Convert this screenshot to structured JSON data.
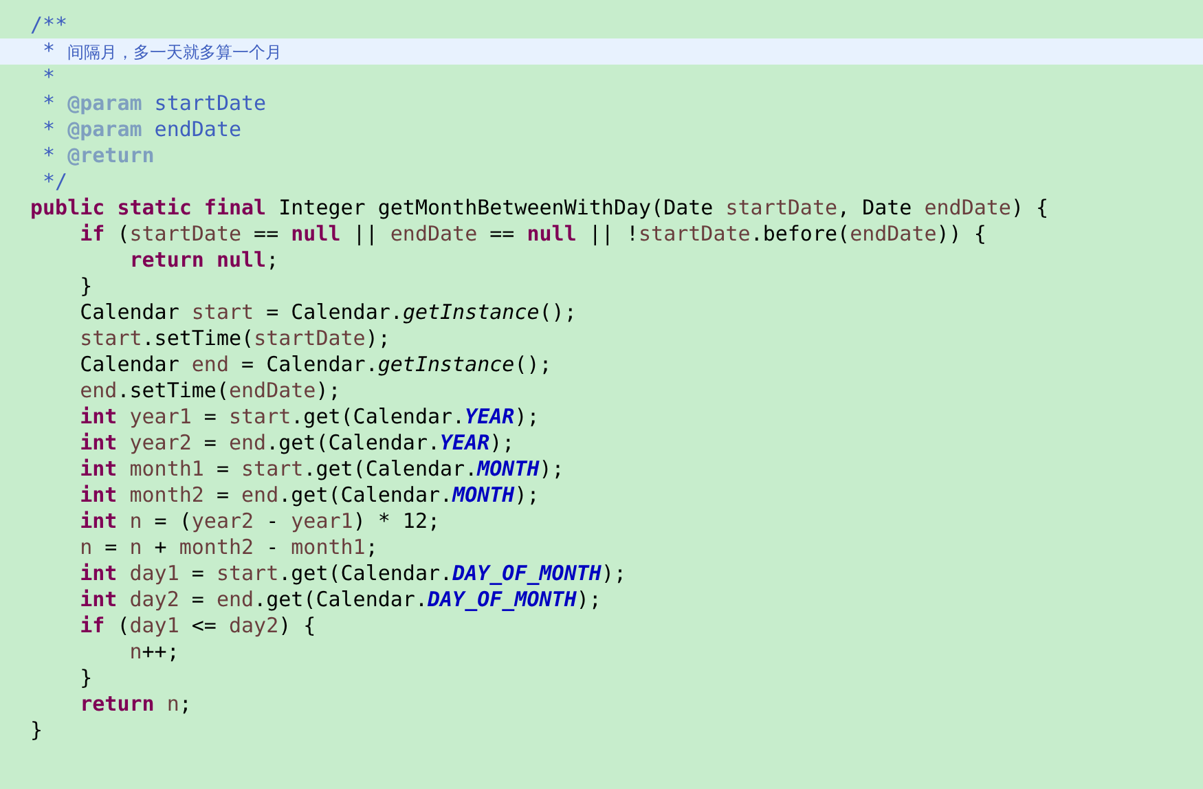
{
  "editor": {
    "lines": [
      {
        "highlighted": false,
        "tokens": [
          {
            "kind": "comment",
            "text": "/**"
          }
        ]
      },
      {
        "highlighted": true,
        "tokens": [
          {
            "kind": "comment",
            "text": " * "
          },
          {
            "kind": "comment_cjk",
            "text": "间隔月，多一天就多算一个月"
          }
        ]
      },
      {
        "highlighted": false,
        "tokens": [
          {
            "kind": "comment",
            "text": " *"
          }
        ]
      },
      {
        "highlighted": false,
        "tokens": [
          {
            "kind": "comment",
            "text": " * "
          },
          {
            "kind": "tag",
            "text": "@param"
          },
          {
            "kind": "comment",
            "text": " startDate"
          }
        ]
      },
      {
        "highlighted": false,
        "tokens": [
          {
            "kind": "comment",
            "text": " * "
          },
          {
            "kind": "tag",
            "text": "@param"
          },
          {
            "kind": "comment",
            "text": " endDate"
          }
        ]
      },
      {
        "highlighted": false,
        "tokens": [
          {
            "kind": "comment",
            "text": " * "
          },
          {
            "kind": "tag",
            "text": "@return"
          }
        ]
      },
      {
        "highlighted": false,
        "tokens": [
          {
            "kind": "comment",
            "text": " */"
          }
        ]
      },
      {
        "highlighted": false,
        "tokens": [
          {
            "kind": "keyword",
            "text": "public static final"
          },
          {
            "kind": "plain",
            "text": " Integer getMonthBetweenWithDay(Date "
          },
          {
            "kind": "variable",
            "text": "startDate"
          },
          {
            "kind": "plain",
            "text": ", Date "
          },
          {
            "kind": "variable",
            "text": "endDate"
          },
          {
            "kind": "plain",
            "text": ") {"
          }
        ]
      },
      {
        "highlighted": false,
        "tokens": [
          {
            "kind": "keyword",
            "text": "    if"
          },
          {
            "kind": "plain",
            "text": " ("
          },
          {
            "kind": "variable",
            "text": "startDate"
          },
          {
            "kind": "plain",
            "text": " == "
          },
          {
            "kind": "keyword",
            "text": "null"
          },
          {
            "kind": "plain",
            "text": " || "
          },
          {
            "kind": "variable",
            "text": "endDate"
          },
          {
            "kind": "plain",
            "text": " == "
          },
          {
            "kind": "keyword",
            "text": "null"
          },
          {
            "kind": "plain",
            "text": " || !"
          },
          {
            "kind": "variable",
            "text": "startDate"
          },
          {
            "kind": "plain",
            "text": ".before("
          },
          {
            "kind": "variable",
            "text": "endDate"
          },
          {
            "kind": "plain",
            "text": ")) {"
          }
        ]
      },
      {
        "highlighted": false,
        "tokens": [
          {
            "kind": "keyword",
            "text": "        return null"
          },
          {
            "kind": "plain",
            "text": ";"
          }
        ]
      },
      {
        "highlighted": false,
        "tokens": [
          {
            "kind": "plain",
            "text": "    }"
          }
        ]
      },
      {
        "highlighted": false,
        "tokens": [
          {
            "kind": "plain",
            "text": "    Calendar "
          },
          {
            "kind": "variable",
            "text": "start"
          },
          {
            "kind": "plain",
            "text": " = Calendar."
          },
          {
            "kind": "method",
            "text": "getInstance"
          },
          {
            "kind": "plain",
            "text": "();"
          }
        ]
      },
      {
        "highlighted": false,
        "tokens": [
          {
            "kind": "variable",
            "text": "    start"
          },
          {
            "kind": "plain",
            "text": ".setTime("
          },
          {
            "kind": "variable",
            "text": "startDate"
          },
          {
            "kind": "plain",
            "text": ");"
          }
        ]
      },
      {
        "highlighted": false,
        "tokens": [
          {
            "kind": "plain",
            "text": "    Calendar "
          },
          {
            "kind": "variable",
            "text": "end"
          },
          {
            "kind": "plain",
            "text": " = Calendar."
          },
          {
            "kind": "method",
            "text": "getInstance"
          },
          {
            "kind": "plain",
            "text": "();"
          }
        ]
      },
      {
        "highlighted": false,
        "tokens": [
          {
            "kind": "variable",
            "text": "    end"
          },
          {
            "kind": "plain",
            "text": ".setTime("
          },
          {
            "kind": "variable",
            "text": "endDate"
          },
          {
            "kind": "plain",
            "text": ");"
          }
        ]
      },
      {
        "highlighted": false,
        "tokens": [
          {
            "kind": "keyword",
            "text": "    int"
          },
          {
            "kind": "variable",
            "text": " year1"
          },
          {
            "kind": "plain",
            "text": " = "
          },
          {
            "kind": "variable",
            "text": "start"
          },
          {
            "kind": "plain",
            "text": ".get(Calendar."
          },
          {
            "kind": "field",
            "text": "YEAR"
          },
          {
            "kind": "plain",
            "text": ");"
          }
        ]
      },
      {
        "highlighted": false,
        "tokens": [
          {
            "kind": "keyword",
            "text": "    int"
          },
          {
            "kind": "variable",
            "text": " year2"
          },
          {
            "kind": "plain",
            "text": " = "
          },
          {
            "kind": "variable",
            "text": "end"
          },
          {
            "kind": "plain",
            "text": ".get(Calendar."
          },
          {
            "kind": "field",
            "text": "YEAR"
          },
          {
            "kind": "plain",
            "text": ");"
          }
        ]
      },
      {
        "highlighted": false,
        "tokens": [
          {
            "kind": "keyword",
            "text": "    int"
          },
          {
            "kind": "variable",
            "text": " month1"
          },
          {
            "kind": "plain",
            "text": " = "
          },
          {
            "kind": "variable",
            "text": "start"
          },
          {
            "kind": "plain",
            "text": ".get(Calendar."
          },
          {
            "kind": "field",
            "text": "MONTH"
          },
          {
            "kind": "plain",
            "text": ");"
          }
        ]
      },
      {
        "highlighted": false,
        "tokens": [
          {
            "kind": "keyword",
            "text": "    int"
          },
          {
            "kind": "variable",
            "text": " month2"
          },
          {
            "kind": "plain",
            "text": " = "
          },
          {
            "kind": "variable",
            "text": "end"
          },
          {
            "kind": "plain",
            "text": ".get(Calendar."
          },
          {
            "kind": "field",
            "text": "MONTH"
          },
          {
            "kind": "plain",
            "text": ");"
          }
        ]
      },
      {
        "highlighted": false,
        "tokens": [
          {
            "kind": "keyword",
            "text": "    int"
          },
          {
            "kind": "variable",
            "text": " n"
          },
          {
            "kind": "plain",
            "text": " = ("
          },
          {
            "kind": "variable",
            "text": "year2"
          },
          {
            "kind": "plain",
            "text": " - "
          },
          {
            "kind": "variable",
            "text": "year1"
          },
          {
            "kind": "plain",
            "text": ") * 12;"
          }
        ]
      },
      {
        "highlighted": false,
        "tokens": [
          {
            "kind": "variable",
            "text": "    n"
          },
          {
            "kind": "plain",
            "text": " = "
          },
          {
            "kind": "variable",
            "text": "n"
          },
          {
            "kind": "plain",
            "text": " + "
          },
          {
            "kind": "variable",
            "text": "month2"
          },
          {
            "kind": "plain",
            "text": " - "
          },
          {
            "kind": "variable",
            "text": "month1"
          },
          {
            "kind": "plain",
            "text": ";"
          }
        ]
      },
      {
        "highlighted": false,
        "tokens": [
          {
            "kind": "keyword",
            "text": "    int"
          },
          {
            "kind": "variable",
            "text": " day1"
          },
          {
            "kind": "plain",
            "text": " = "
          },
          {
            "kind": "variable",
            "text": "start"
          },
          {
            "kind": "plain",
            "text": ".get(Calendar."
          },
          {
            "kind": "field",
            "text": "DAY_OF_MONTH"
          },
          {
            "kind": "plain",
            "text": ");"
          }
        ]
      },
      {
        "highlighted": false,
        "tokens": [
          {
            "kind": "keyword",
            "text": "    int"
          },
          {
            "kind": "variable",
            "text": " day2"
          },
          {
            "kind": "plain",
            "text": " = "
          },
          {
            "kind": "variable",
            "text": "end"
          },
          {
            "kind": "plain",
            "text": ".get(Calendar."
          },
          {
            "kind": "field",
            "text": "DAY_OF_MONTH"
          },
          {
            "kind": "plain",
            "text": ");"
          }
        ]
      },
      {
        "highlighted": false,
        "tokens": [
          {
            "kind": "keyword",
            "text": "    if"
          },
          {
            "kind": "plain",
            "text": " ("
          },
          {
            "kind": "variable",
            "text": "day1"
          },
          {
            "kind": "plain",
            "text": " <= "
          },
          {
            "kind": "variable",
            "text": "day2"
          },
          {
            "kind": "plain",
            "text": ") {"
          }
        ]
      },
      {
        "highlighted": false,
        "tokens": [
          {
            "kind": "variable",
            "text": "        n"
          },
          {
            "kind": "plain",
            "text": "++;"
          }
        ]
      },
      {
        "highlighted": false,
        "tokens": [
          {
            "kind": "plain",
            "text": "    }"
          }
        ]
      },
      {
        "highlighted": false,
        "tokens": [
          {
            "kind": "keyword",
            "text": "    return"
          },
          {
            "kind": "variable",
            "text": " n"
          },
          {
            "kind": "plain",
            "text": ";"
          }
        ]
      },
      {
        "highlighted": false,
        "tokens": [
          {
            "kind": "plain",
            "text": "}"
          }
        ]
      }
    ]
  }
}
